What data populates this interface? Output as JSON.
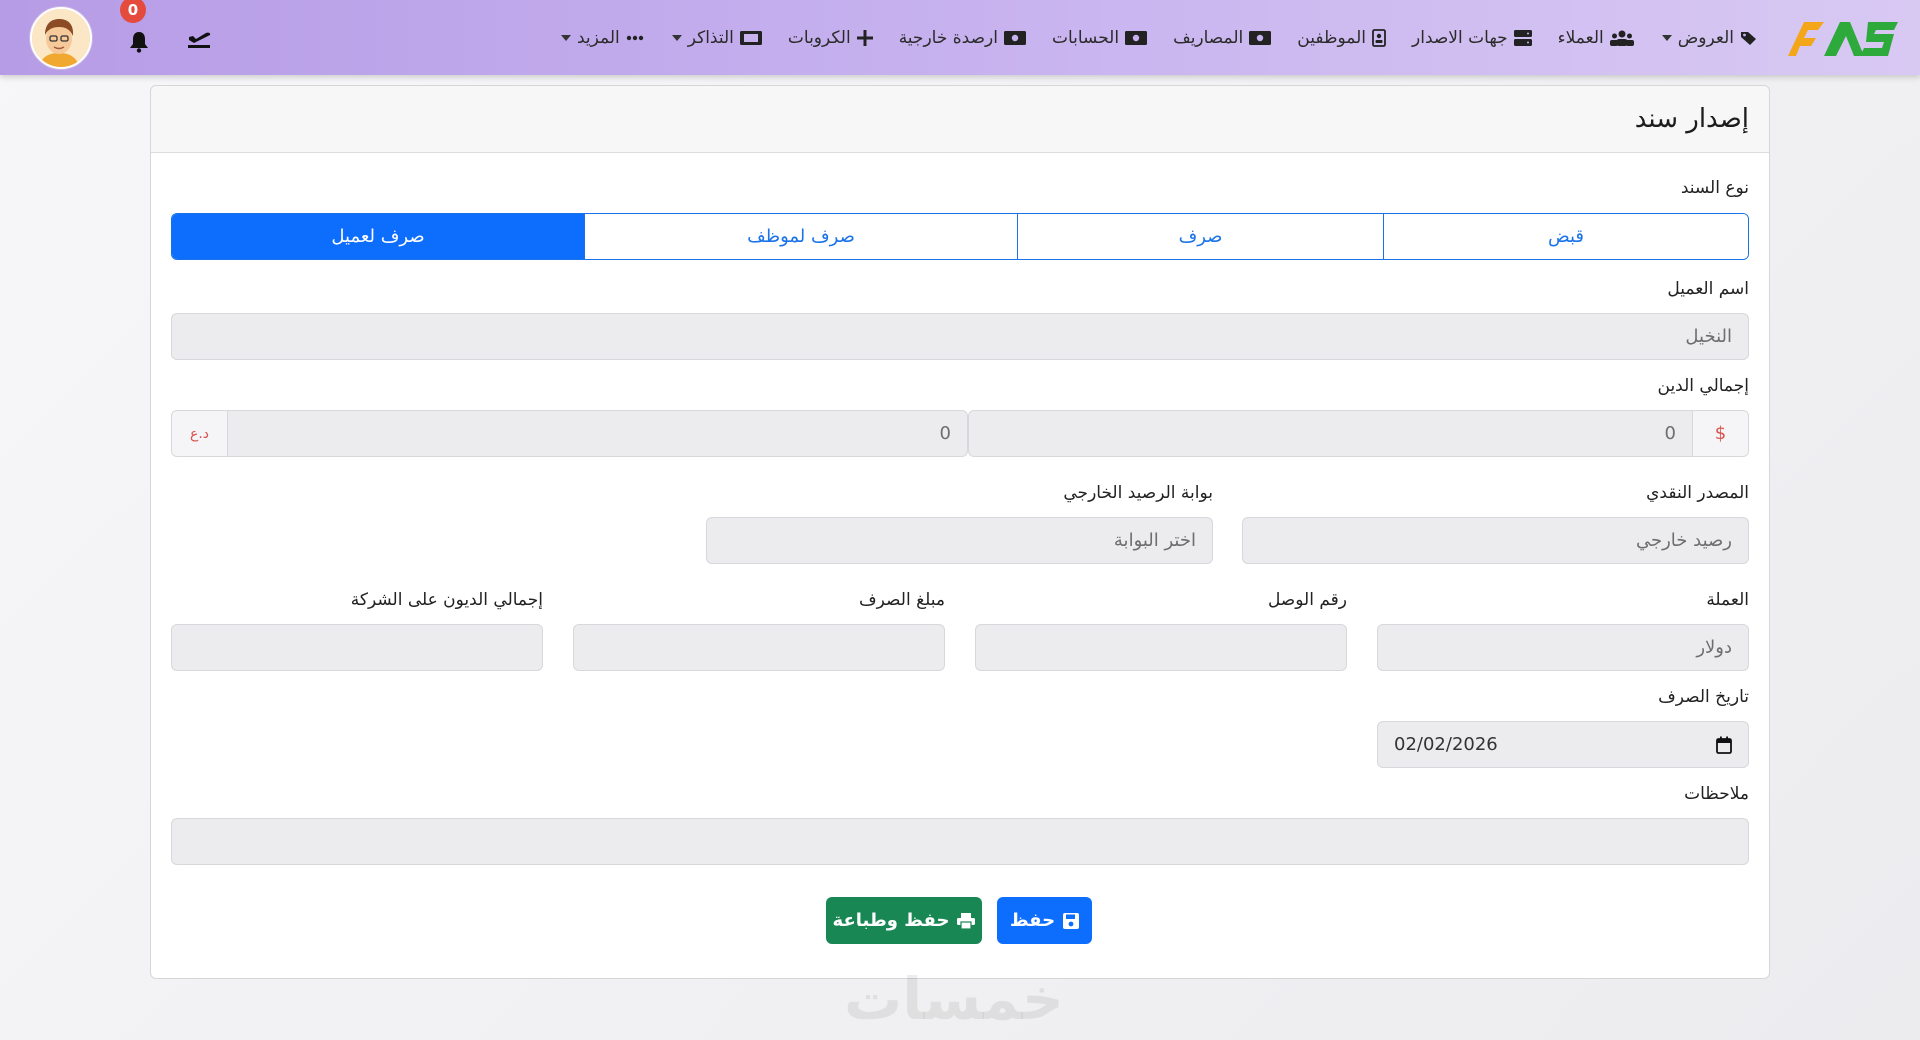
{
  "nav": {
    "offers": "العروض",
    "clients": "العملاء",
    "issuers": "جهات الاصدار",
    "employees": "الموظفين",
    "expenses": "المصاريف",
    "accounts": "الحسابات",
    "external_balances": "ارصدة خارجية",
    "groups": "الكروبات",
    "tickets": "التذاكر",
    "more": "المزيد",
    "notifications_count": "0"
  },
  "page": {
    "title": "إصدار سند"
  },
  "form": {
    "voucher_type_label": "نوع السند",
    "voucher_types": [
      {
        "label": "قبض",
        "active": false
      },
      {
        "label": "صرف",
        "active": false
      },
      {
        "label": "صرف لموظف",
        "active": false
      },
      {
        "label": "صرف لعميل",
        "active": true
      }
    ],
    "client_name_label": "اسم العميل",
    "client_name_value": "النخيل",
    "total_debt_label": "إجمالي الدين",
    "debt_usd_symbol": "$",
    "debt_usd_value": "0",
    "debt_iqd_symbol": "د.ع",
    "debt_iqd_value": "0",
    "cash_source_label": "المصدر النقدي",
    "cash_source_value": "رصيد خارجي",
    "gateway_label": "بوابة الرصيد الخارجي",
    "gateway_placeholder": "اختر البوابة",
    "currency_label": "العملة",
    "currency_value": "دولار",
    "receipt_no_label": "رقم الوصل",
    "amount_label": "مبلغ الصرف",
    "company_debt_label": "إجمالي الديون على الشركة",
    "date_label": "تاريخ الصرف",
    "date_value": "02/02/2026",
    "notes_label": "ملاحظات",
    "save_label": "حفظ",
    "save_print_label": "حفظ وطباعة"
  },
  "watermark": "خمسات",
  "colors": {
    "primary": "#0d6efd",
    "success": "#198754",
    "danger": "#d9534f",
    "nav_from": "#b69ce6",
    "nav_to": "#d8c9f3"
  }
}
